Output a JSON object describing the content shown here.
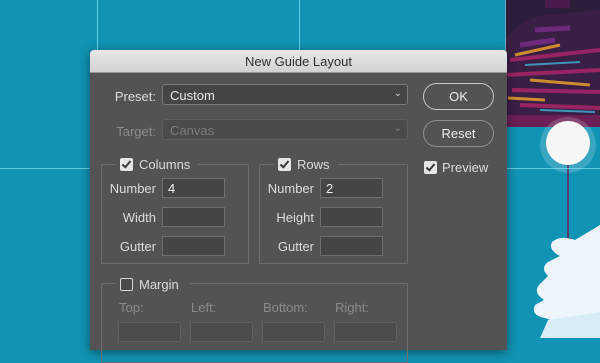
{
  "dialog": {
    "title": "New Guide Layout",
    "preset_label": "Preset:",
    "preset_value": "Custom",
    "target_label": "Target:",
    "target_value": "Canvas",
    "ok_label": "OK",
    "reset_label": "Reset",
    "preview_label": "Preview",
    "preview_checked": true,
    "columns": {
      "label": "Columns",
      "checked": true,
      "number_label": "Number",
      "number_value": "4",
      "width_label": "Width",
      "width_value": "",
      "gutter_label": "Gutter",
      "gutter_value": ""
    },
    "rows": {
      "label": "Rows",
      "checked": true,
      "number_label": "Number",
      "number_value": "2",
      "height_label": "Height",
      "height_value": "",
      "gutter_label": "Gutter",
      "gutter_value": ""
    },
    "margin": {
      "label": "Margin",
      "checked": false,
      "top_label": "Top:",
      "left_label": "Left:",
      "bottom_label": "Bottom:",
      "right_label": "Right:"
    }
  },
  "colors": {
    "canvas": "#1093b4",
    "guide": "#7fe0f2",
    "dialog_bg": "#535353",
    "titlebar": "#dcdcdc"
  },
  "icons": [
    "chevron-down-icon",
    "checkmark-icon"
  ]
}
